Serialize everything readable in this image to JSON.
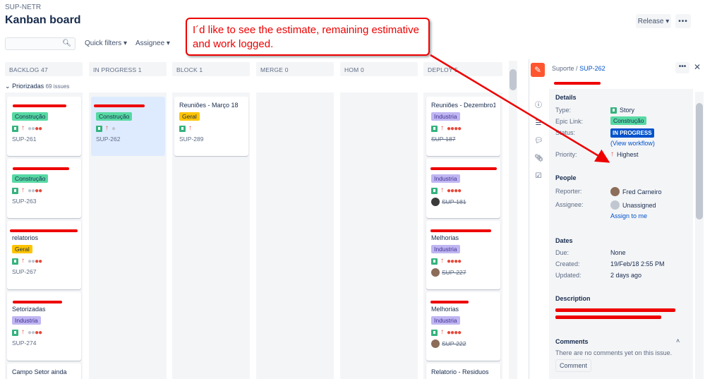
{
  "header": {
    "project_key": "SUP-NETR",
    "title": "Kanban board",
    "release_label": "Release ▾",
    "more_label": "•••"
  },
  "toolbar": {
    "quick_filters": "Quick filters",
    "assignee": "Assignee"
  },
  "columns": [
    {
      "name": "BACKLOG 47"
    },
    {
      "name": "IN PROGRESS 1"
    },
    {
      "name": "BLOCK 1"
    },
    {
      "name": "MERGE 0"
    },
    {
      "name": "HOM 0"
    },
    {
      "name": "DEPLOY 5"
    }
  ],
  "swimlane": {
    "label": "Priorizadas",
    "count": "69 issues"
  },
  "cards": {
    "c1": {
      "epic": "Construção",
      "key": "SUP-261"
    },
    "c2": {
      "epic": "Construção",
      "key": "SUP-263"
    },
    "c3": {
      "title": "relatorios",
      "epic": "Geral",
      "key": "SUP-267"
    },
    "c4": {
      "title": "Setorizadas",
      "epic": "Industria",
      "key": "SUP-274"
    },
    "c5": {
      "title": "Campo Setor ainda"
    },
    "p1": {
      "epic": "Construção",
      "key": "SUP-262"
    },
    "b1": {
      "title": "Reuniões - Março 18",
      "epic": "Geral",
      "key": "SUP-289"
    },
    "d1": {
      "title": "Reuniões - Dezembro17",
      "epic": "Industria",
      "key": "SUP-187"
    },
    "d2": {
      "epic": "Industria",
      "key": "SUP-181"
    },
    "d3": {
      "title": "Melhorias",
      "epic": "Industria",
      "key": "SUP-227"
    },
    "d4": {
      "title": "Melhorias",
      "epic": "Industria",
      "key": "SUP-222"
    },
    "d5": {
      "title": "Relatorio - Residuos"
    }
  },
  "panel": {
    "breadcrumb_project": "Suporte",
    "breadcrumb_sep": "/",
    "issue_key": "SUP-262",
    "more": "•••",
    "close": "✕",
    "details_heading": "Details",
    "type_label": "Type:",
    "type_value": "Story",
    "epic_label": "Epic Link:",
    "epic_value": "Construção",
    "status_label": "Status:",
    "status_value": "IN PROGRESS",
    "view_workflow": "(View workflow)",
    "priority_label": "Priority:",
    "priority_value": "Highest",
    "people_heading": "People",
    "reporter_label": "Reporter:",
    "reporter_value": "Fred Carneiro",
    "assignee_label": "Assignee:",
    "assignee_value": "Unassigned",
    "assign_to_me": "Assign to me",
    "dates_heading": "Dates",
    "due_label": "Due:",
    "due_value": "None",
    "created_label": "Created:",
    "created_value": "19/Feb/18 2:55 PM",
    "updated_label": "Updated:",
    "updated_value": "2 days ago",
    "description_heading": "Description",
    "comments_heading": "Comments",
    "no_comments": "There are no comments yet on this issue.",
    "comment_button": "Comment"
  },
  "callout": {
    "text": "I´d like to see the estimate, remaining estimative and work logged."
  },
  "colors": {
    "annotation_red": "#ee0000",
    "status_blue": "#0052cc",
    "epic_green": "#57d9a3",
    "epic_yellow": "#ffc400",
    "epic_purple": "#c0b6f2"
  }
}
